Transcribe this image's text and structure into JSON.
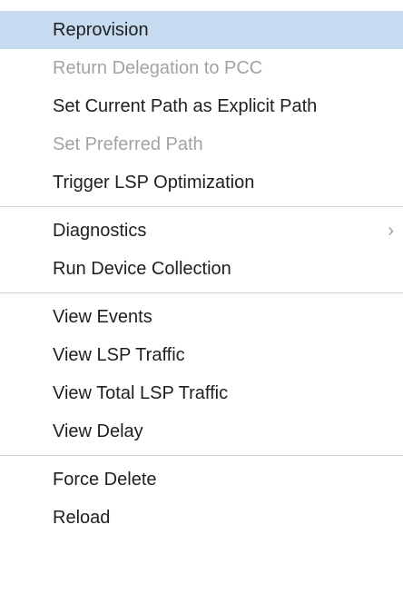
{
  "menu": {
    "groups": [
      {
        "items": [
          {
            "label": "Reprovision",
            "state": "highlighted"
          },
          {
            "label": "Return Delegation to PCC",
            "state": "disabled"
          },
          {
            "label": "Set Current Path as Explicit Path",
            "state": "enabled"
          },
          {
            "label": "Set Preferred Path",
            "state": "disabled"
          },
          {
            "label": "Trigger LSP Optimization",
            "state": "enabled"
          }
        ]
      },
      {
        "items": [
          {
            "label": "Diagnostics",
            "state": "enabled",
            "submenu_icon": "chevron-right-icon",
            "submenu_glyph": "›"
          },
          {
            "label": "Run Device Collection",
            "state": "enabled"
          }
        ]
      },
      {
        "items": [
          {
            "label": "View Events",
            "state": "enabled"
          },
          {
            "label": "View LSP Traffic",
            "state": "enabled"
          },
          {
            "label": "View Total LSP Traffic",
            "state": "enabled"
          },
          {
            "label": "View Delay",
            "state": "enabled"
          }
        ]
      },
      {
        "items": [
          {
            "label": "Force Delete",
            "state": "enabled"
          },
          {
            "label": "Reload",
            "state": "enabled"
          }
        ]
      }
    ],
    "colors": {
      "highlight_bg": "#c6daf0",
      "text": "#1f1f1f",
      "disabled_text": "#a3a3a3",
      "separator": "#d6d6d6"
    }
  }
}
